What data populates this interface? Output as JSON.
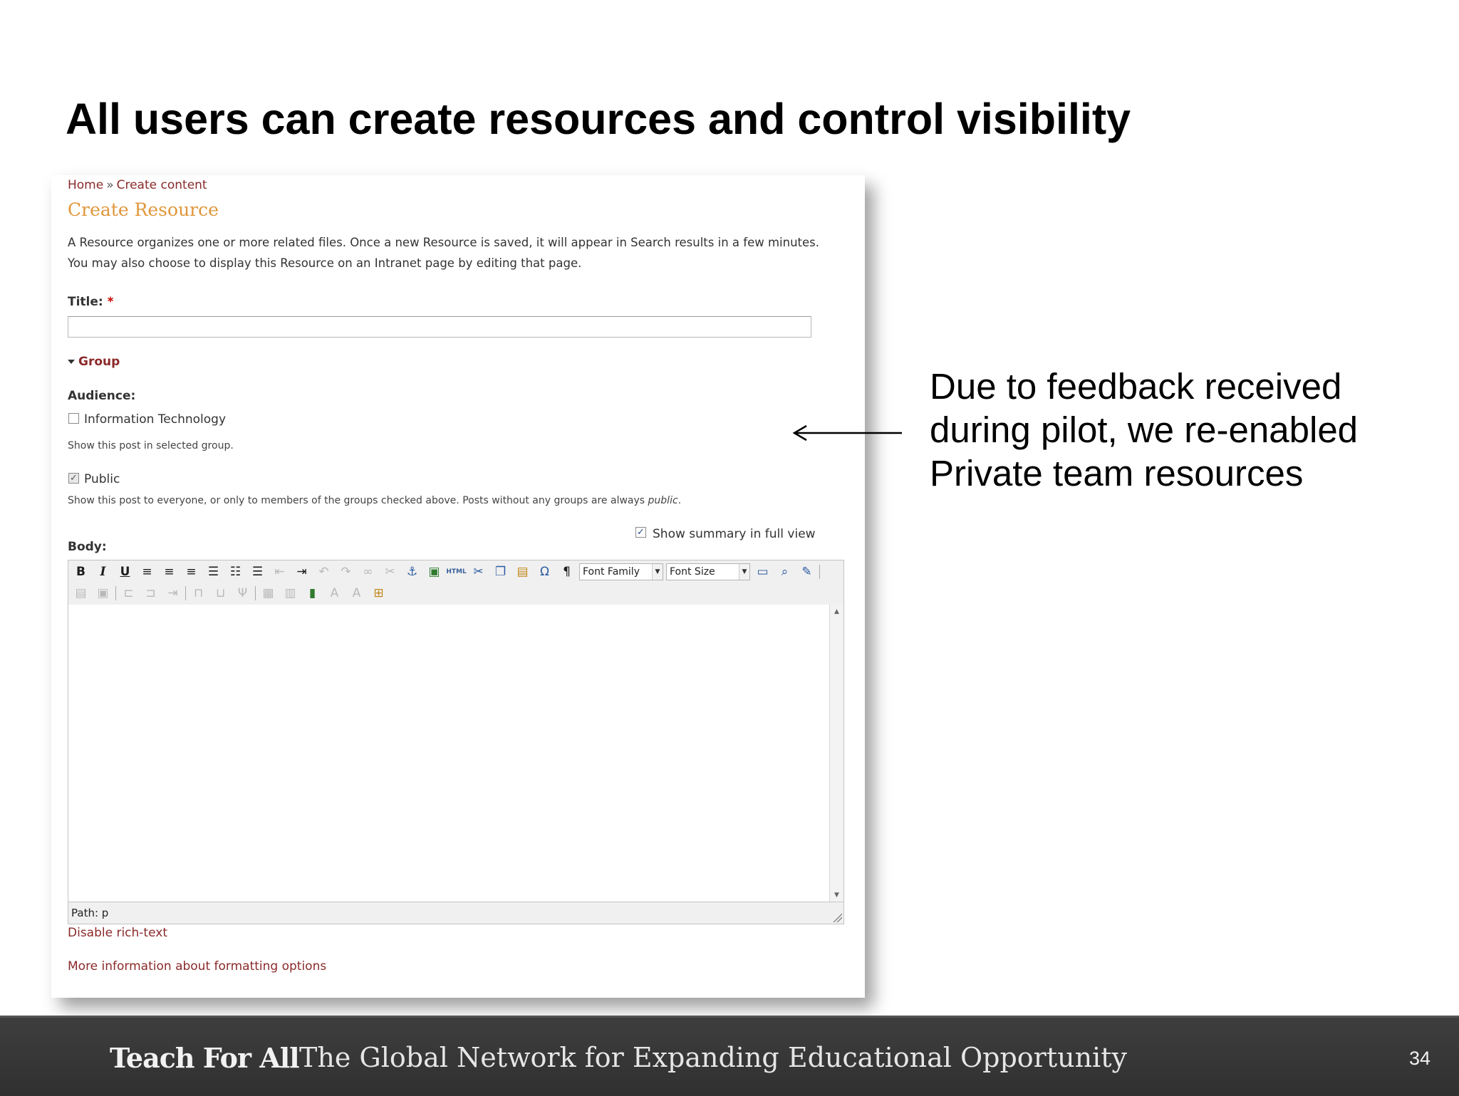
{
  "slide": {
    "title": "All users can create resources and control visibility",
    "annotation": "Due to feedback received during pilot, we re-enabled Private team resources",
    "page_number": "34"
  },
  "footer": {
    "brand": "Teach For All",
    "tagline": "The Global Network for Expanding Educational Opportunity"
  },
  "screenshot": {
    "breadcrumb": {
      "home": "Home",
      "separator": "»",
      "current": "Create content"
    },
    "heading": "Create Resource",
    "description_line1": "A Resource organizes one or more related files. Once a new Resource is saved, it will appear in Search results in a few minutes.",
    "description_line2": "You may also choose to display this Resource on an Intranet page by editing that page.",
    "title_label": "Title:",
    "required_mark": "*",
    "title_value": "",
    "group_toggle": "Group",
    "audience_label": "Audience:",
    "options": [
      {
        "label": "Information Technology",
        "checked": false,
        "help": "Show this post in selected group."
      },
      {
        "label": "Public",
        "checked": true,
        "disabled": true,
        "help": "Show this post to everyone, or only to members of the groups checked above. Posts without any groups are always",
        "help_em": "public",
        "help_end": "."
      }
    ],
    "show_summary": {
      "label": "Show summary in full view",
      "checked": true
    },
    "body_label": "Body:",
    "toolbar": {
      "font_family": "Font Family",
      "font_size": "Font Size",
      "html_button": "HTML"
    },
    "body_value": "",
    "path_label": "Path: p",
    "disable_rich_text": "Disable rich-text",
    "more_info": "More information about formatting options"
  }
}
